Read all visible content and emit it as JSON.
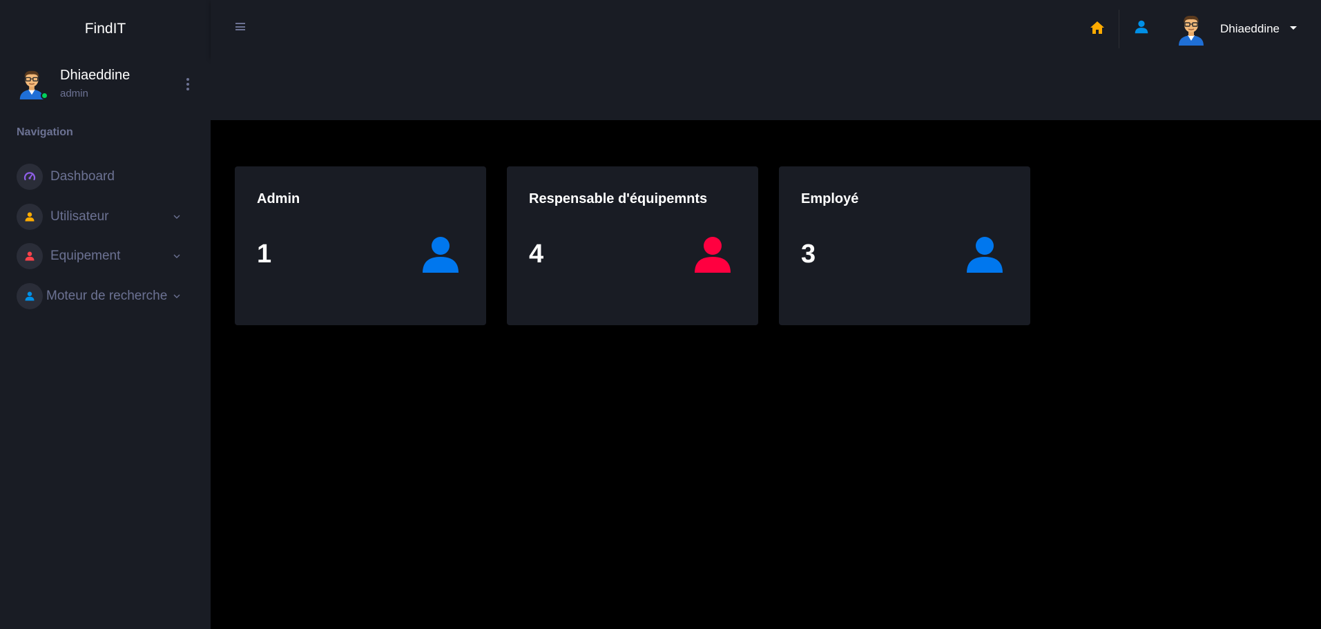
{
  "brand": "FindIT",
  "profile": {
    "name": "Dhiaeddine",
    "role": "admin"
  },
  "navigation": {
    "heading": "Navigation",
    "items": [
      {
        "label": "Dashboard",
        "icon": "speedometer-icon",
        "color": "#8f5fe8",
        "has_submenu": false
      },
      {
        "label": "Utilisateur",
        "icon": "user-icon",
        "color": "#ffab00",
        "has_submenu": true
      },
      {
        "label": "Equipement",
        "icon": "user-icon",
        "color": "#fc424a",
        "has_submenu": true
      },
      {
        "label": "Moteur de recherche",
        "icon": "user-icon",
        "color": "#0090e7",
        "has_submenu": true
      }
    ]
  },
  "topbar": {
    "user_name": "Dhiaeddine",
    "home_icon_color": "#ffab00",
    "user_icon_color": "#0090e7"
  },
  "cards": [
    {
      "title": "Admin",
      "count": "1",
      "icon": "user-icon",
      "icon_color": "#0077ee"
    },
    {
      "title": "Respensable d'équipemnts",
      "count": "4",
      "icon": "user-icon",
      "icon_color": "#ff0040"
    },
    {
      "title": "Employé",
      "count": "3",
      "icon": "user-icon",
      "icon_color": "#0077ee"
    }
  ],
  "colors": {
    "sidebar_bg": "#191c24",
    "content_bg": "#000000",
    "muted_text": "#6c7293",
    "online": "#00d25b"
  }
}
